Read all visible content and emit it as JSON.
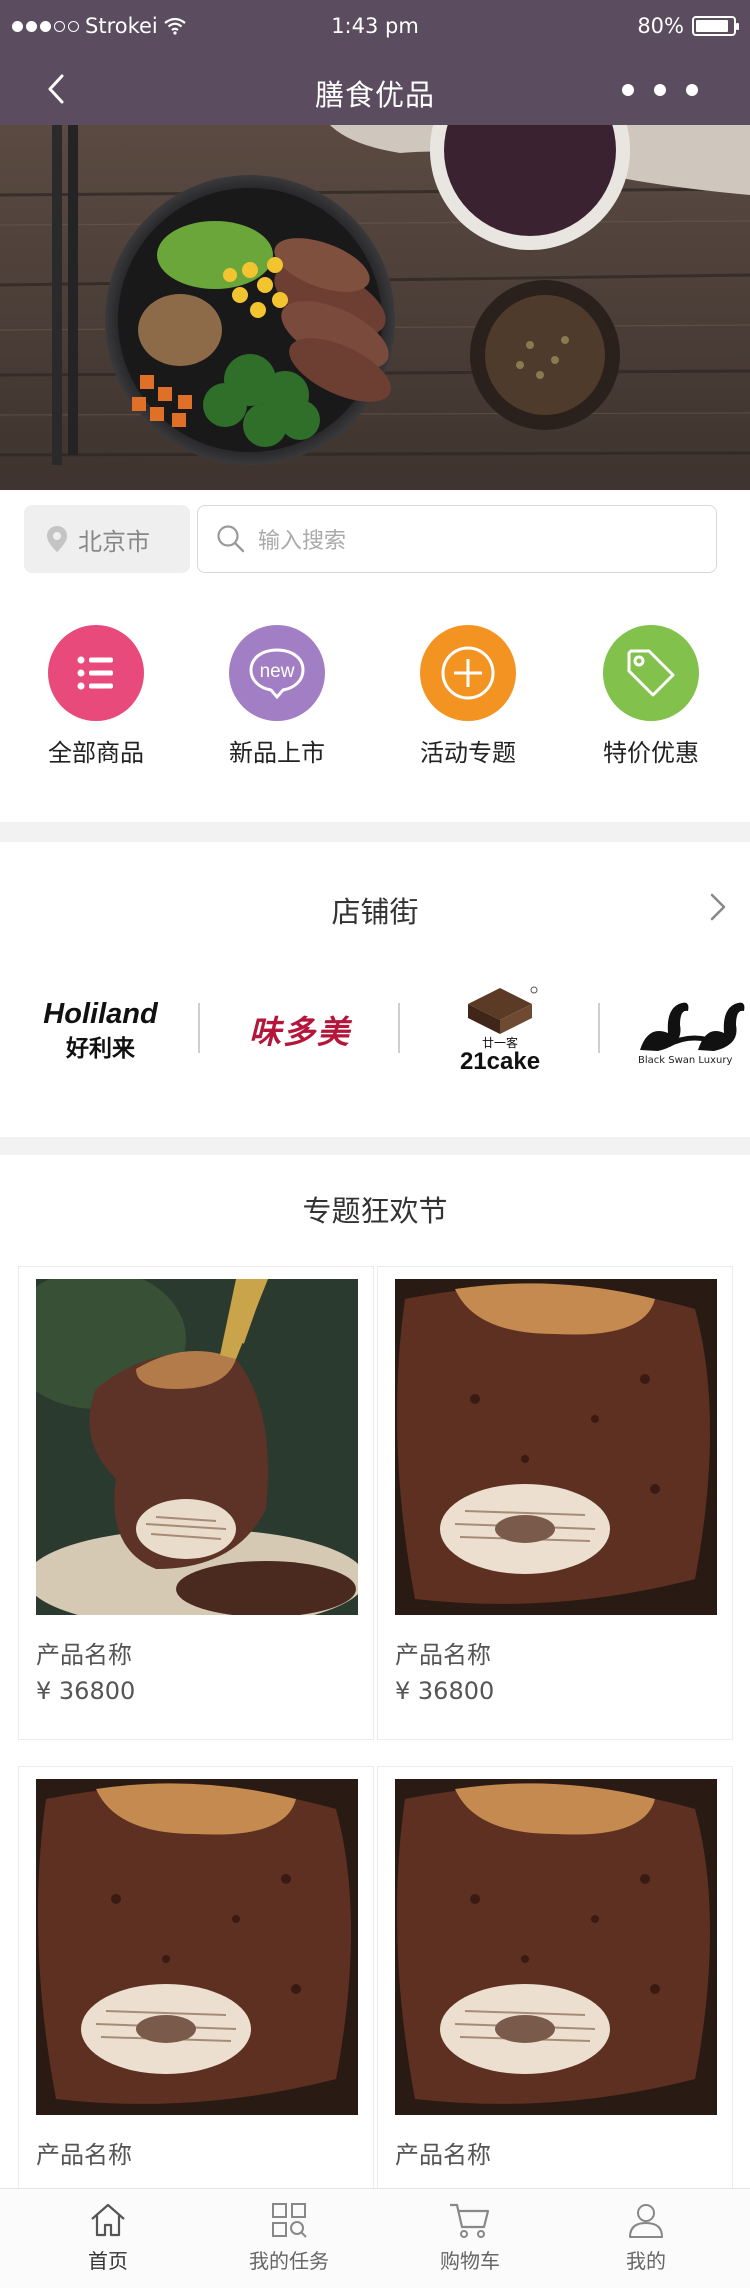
{
  "status_bar": {
    "carrier": "Strokei",
    "time": "1:43 pm",
    "battery": "80%"
  },
  "nav": {
    "title": "膳食优品"
  },
  "search": {
    "city": "北京市",
    "placeholder": "输入搜索"
  },
  "categories": [
    {
      "label": "全部商品",
      "color": "#e94a7c",
      "icon": "list-icon"
    },
    {
      "label": "新品上市",
      "color": "#a27fc4",
      "icon": "new-badge-icon"
    },
    {
      "label": "活动专题",
      "color": "#f39422",
      "icon": "plus-circle-icon"
    },
    {
      "label": "特价优惠",
      "color": "#82c14b",
      "icon": "price-tag-icon"
    }
  ],
  "stores": {
    "title": "店铺街",
    "brands": [
      {
        "name": "Holiland",
        "sub": "好利来"
      },
      {
        "name": "味多美"
      },
      {
        "name": "21cake",
        "sub": "廿一客"
      },
      {
        "name": "Black Swan Luxury"
      }
    ]
  },
  "featured": {
    "title": "专题狂欢节",
    "products": [
      {
        "name": "产品名称",
        "price": "¥ 36800"
      },
      {
        "name": "产品名称",
        "price": "¥ 36800"
      },
      {
        "name": "产品名称",
        "price": ""
      },
      {
        "name": "产品名称",
        "price": ""
      }
    ]
  },
  "tabbar": [
    {
      "label": "首页",
      "icon": "home-icon"
    },
    {
      "label": "我的任务",
      "icon": "tasks-icon"
    },
    {
      "label": "购物车",
      "icon": "cart-icon"
    },
    {
      "label": "我的",
      "icon": "profile-icon"
    }
  ]
}
